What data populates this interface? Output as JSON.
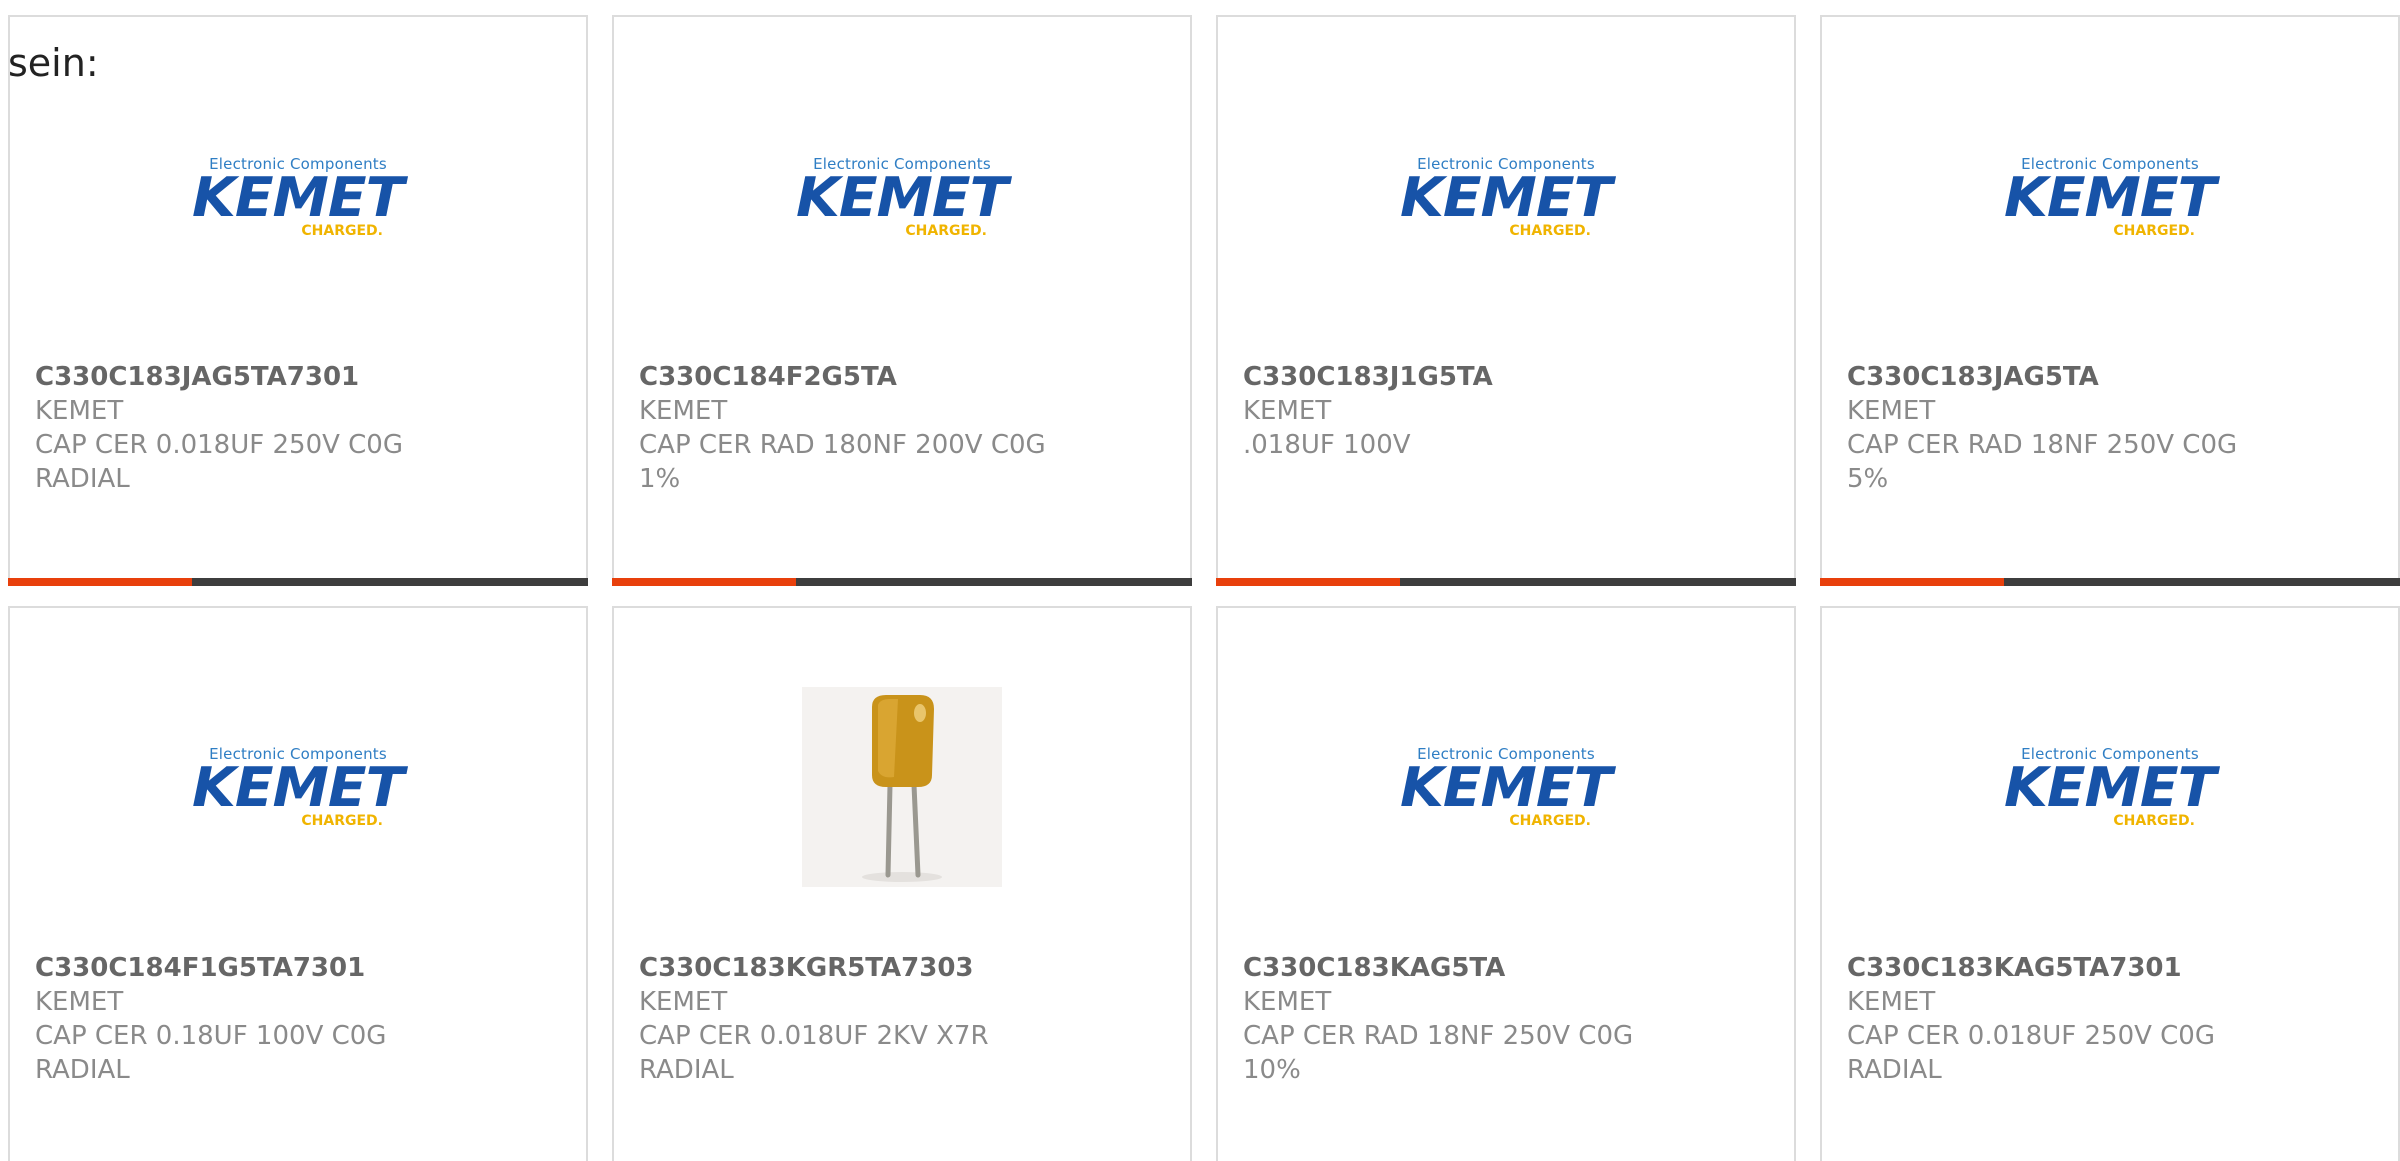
{
  "intro_text": "sein:",
  "logo": {
    "top_text": "Electronic Components",
    "word": "KEMET",
    "tag": "CHARGED."
  },
  "colors": {
    "accent": "#e8400c",
    "bar": "#3d3d3d",
    "brand_blue": "#1753a8",
    "brand_yellow": "#f0b400",
    "card_border": "#dcdcdc"
  },
  "products": [
    {
      "part": "C330C183JAG5TA7301",
      "maker": "KEMET",
      "desc1": "CAP CER 0.018UF 250V C0G",
      "desc2": "RADIAL",
      "image": "kemet-logo"
    },
    {
      "part": "C330C184F2G5TA",
      "maker": "KEMET",
      "desc1": "CAP CER RAD 180NF 200V C0G",
      "desc2": "1%",
      "image": "kemet-logo"
    },
    {
      "part": "C330C183J1G5TA",
      "maker": "KEMET",
      "desc1": ".018UF 100V",
      "desc2": "",
      "image": "kemet-logo"
    },
    {
      "part": "C330C183JAG5TA",
      "maker": "KEMET",
      "desc1": "CAP CER RAD 18NF 250V C0G",
      "desc2": "5%",
      "image": "kemet-logo"
    },
    {
      "part": "C330C184F1G5TA7301",
      "maker": "KEMET",
      "desc1": "CAP CER 0.18UF 100V C0G",
      "desc2": "RADIAL",
      "image": "kemet-logo"
    },
    {
      "part": "C330C183KGR5TA7303",
      "maker": "KEMET",
      "desc1": "CAP CER 0.018UF 2KV X7R",
      "desc2": "RADIAL",
      "image": "capacitor-photo"
    },
    {
      "part": "C330C183KAG5TA",
      "maker": "KEMET",
      "desc1": "CAP CER RAD 18NF 250V C0G",
      "desc2": "10%",
      "image": "kemet-logo"
    },
    {
      "part": "C330C183KAG5TA7301",
      "maker": "KEMET",
      "desc1": "CAP CER 0.018UF 250V C0G",
      "desc2": "RADIAL",
      "image": "kemet-logo"
    }
  ]
}
